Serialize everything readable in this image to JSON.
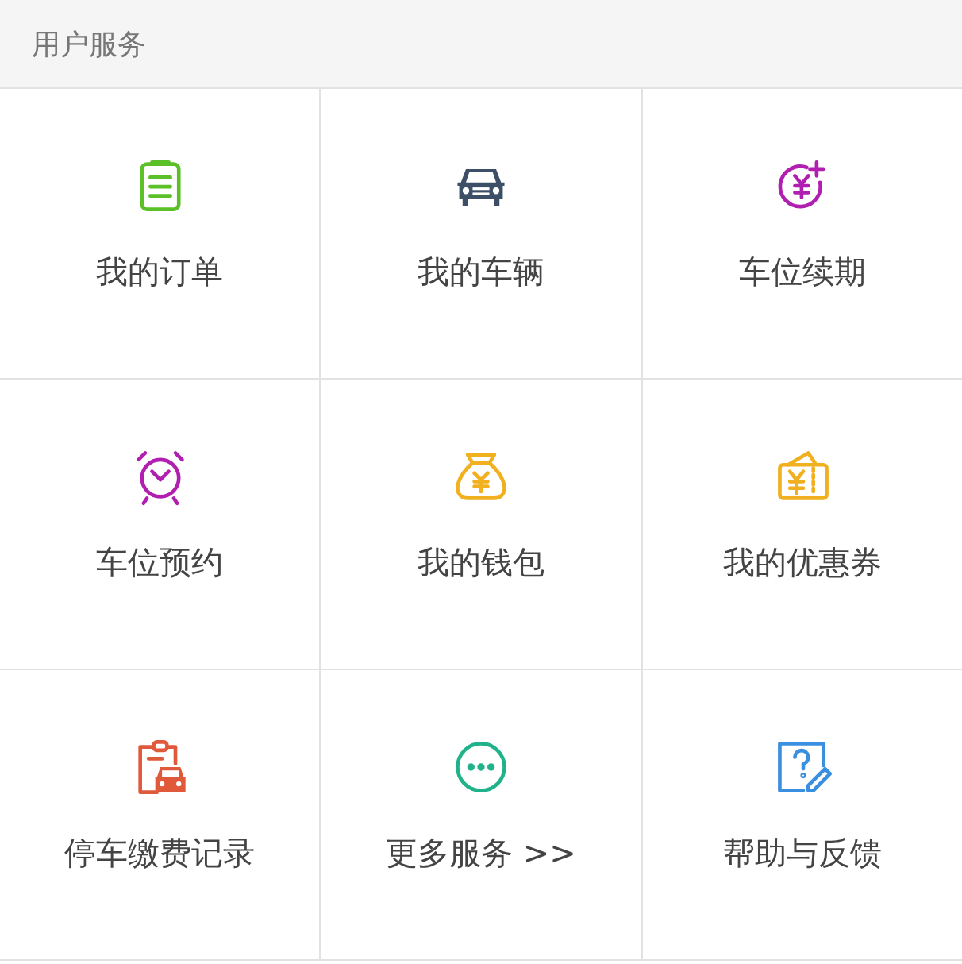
{
  "section": {
    "title": "用户服务"
  },
  "services": [
    {
      "label": "我的订单"
    },
    {
      "label": "我的车辆"
    },
    {
      "label": "车位续期"
    },
    {
      "label": "车位预约"
    },
    {
      "label": "我的钱包"
    },
    {
      "label": "我的优惠券"
    },
    {
      "label": "停车缴费记录"
    },
    {
      "label": "更多服务 >>"
    },
    {
      "label": "帮助与反馈"
    }
  ]
}
